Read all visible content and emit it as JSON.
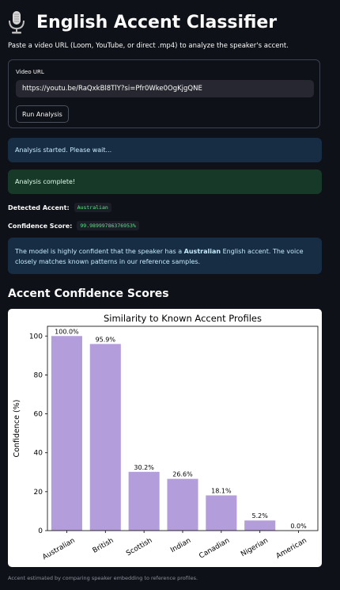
{
  "header": {
    "title": "English Accent Classifier",
    "subtitle": "Paste a video URL (Loom, YouTube, or direct .mp4) to analyze the speaker's accent."
  },
  "form": {
    "field_label": "Video URL",
    "url_value": "https://youtu.be/RaQxkBl8TlY?si=Pfr0Wke0OgKjgQNE",
    "run_button": "Run Analysis"
  },
  "status": {
    "started": "Analysis started. Please wait...",
    "complete": "Analysis complete!"
  },
  "result": {
    "accent_label": "Detected Accent:",
    "accent_value": "Australian",
    "confidence_label": "Confidence Score:",
    "confidence_value": "99.98999786376953%",
    "desc_pre": "The model is highly confident that the speaker has a ",
    "desc_bold": "Australian",
    "desc_post": " English accent. The voice closely matches known patterns in our reference samples."
  },
  "section_title": "Accent Confidence Scores",
  "caption": "Accent estimated by comparing speaker embedding to reference profiles.",
  "colors": {
    "background": "#0e1117",
    "info_bg": "#172d43",
    "success_bg": "#173928",
    "code_green": "#5ce488",
    "bar": "#b39ddb"
  },
  "icons": {
    "title_icon": "microphone-icon"
  },
  "chart_data": {
    "type": "bar",
    "title": "Similarity to Known Accent Profiles",
    "ylabel": "Confidence (%)",
    "xlabel": "",
    "categories": [
      "Australian",
      "British",
      "Scottish",
      "Indian",
      "Canadian",
      "Nigerian",
      "American"
    ],
    "values": [
      100.0,
      95.9,
      30.2,
      26.6,
      18.1,
      5.2,
      0.0
    ],
    "data_labels": [
      "100.0%",
      "95.9%",
      "30.2%",
      "26.6%",
      "18.1%",
      "5.2%",
      "0.0%"
    ],
    "ylim": [
      0,
      105
    ],
    "yticks": [
      0,
      20,
      40,
      60,
      80,
      100
    ],
    "ytick_labels": [
      "0",
      "20",
      "40",
      "60",
      "80",
      "100"
    ],
    "grid": false,
    "bar_color": "#b39ddb"
  }
}
